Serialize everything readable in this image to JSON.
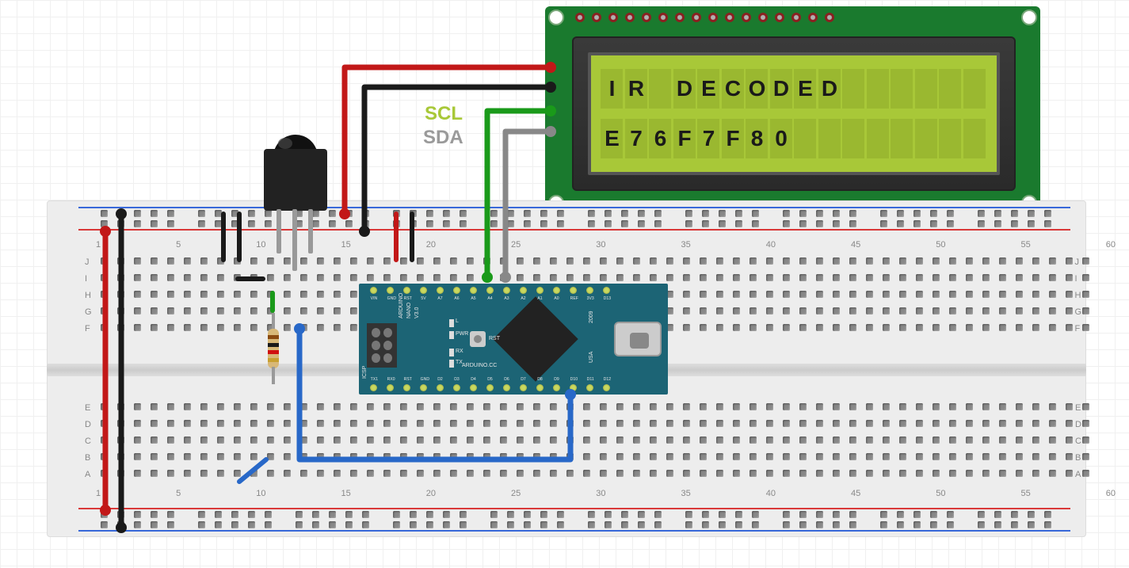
{
  "lcd": {
    "line1": "IR DECODED",
    "line2": "E76F7F80",
    "cols": 16
  },
  "wire_labels": {
    "scl": "SCL",
    "sda": "SDA"
  },
  "colors": {
    "scl_label": "#a8c838",
    "sda_label": "#9a9a9a",
    "wire_red": "#c21818",
    "wire_black": "#1a1a1a",
    "wire_green": "#1a9a1a",
    "wire_gray": "#888888",
    "wire_blue": "#2868c8"
  },
  "breadboard": {
    "col_numbers": [
      "1",
      "5",
      "10",
      "15",
      "20",
      "25",
      "30",
      "35",
      "40",
      "45",
      "50",
      "55",
      "60"
    ],
    "row_letters_top": [
      "J",
      "I",
      "H",
      "G",
      "F"
    ],
    "row_letters_bot": [
      "E",
      "D",
      "C",
      "B",
      "A"
    ]
  },
  "nano": {
    "name": "ARDUINO",
    "model1": "NANO",
    "model2": "V3.0",
    "site": "ARDUINO.CC",
    "icsp": "ICSP",
    "usa": "USA",
    "year": "2009",
    "led_pwr": "PWR",
    "led_tx": "TX",
    "led_rx": "RX",
    "rst": "RST",
    "led_l": "L",
    "pins_top": [
      "VIN",
      "GND",
      "RST",
      "5V",
      "A7",
      "A6",
      "A5",
      "A4",
      "A3",
      "A2",
      "A1",
      "A0",
      "REF",
      "3V3",
      "D13"
    ],
    "pins_bot": [
      "TX1",
      "RX0",
      "RST",
      "GND",
      "D2",
      "D3",
      "D4",
      "D5",
      "D6",
      "D7",
      "D8",
      "D9",
      "D10",
      "D11",
      "D12"
    ]
  },
  "resistor": {
    "bands": [
      "#8a4a10",
      "#1a1a1a",
      "#d01010",
      "#c8a030"
    ]
  }
}
